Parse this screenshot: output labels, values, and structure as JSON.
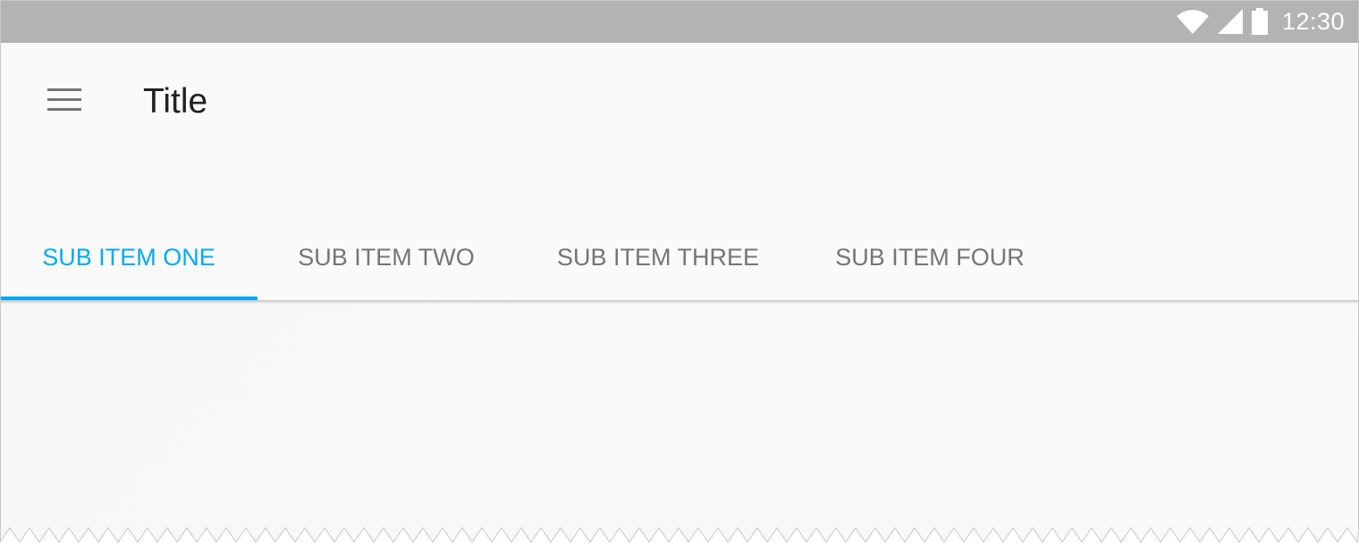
{
  "status_bar": {
    "time": "12:30",
    "icons": [
      "wifi-icon",
      "cell-signal-icon",
      "battery-icon"
    ],
    "background": "#b3b3b3"
  },
  "app_bar": {
    "menu_icon": "hamburger-menu-icon",
    "title": "Title",
    "background": "#fafafa"
  },
  "tabs": [
    {
      "label": "SUB ITEM ONE",
      "active": true
    },
    {
      "label": "SUB ITEM TWO",
      "active": false
    },
    {
      "label": "SUB ITEM THREE",
      "active": false
    },
    {
      "label": "SUB ITEM FOUR",
      "active": false
    }
  ],
  "colors": {
    "accent": "#03a9f4",
    "title_text": "#212121",
    "tab_text": "#757575",
    "content_background": "#f7f7f7"
  }
}
